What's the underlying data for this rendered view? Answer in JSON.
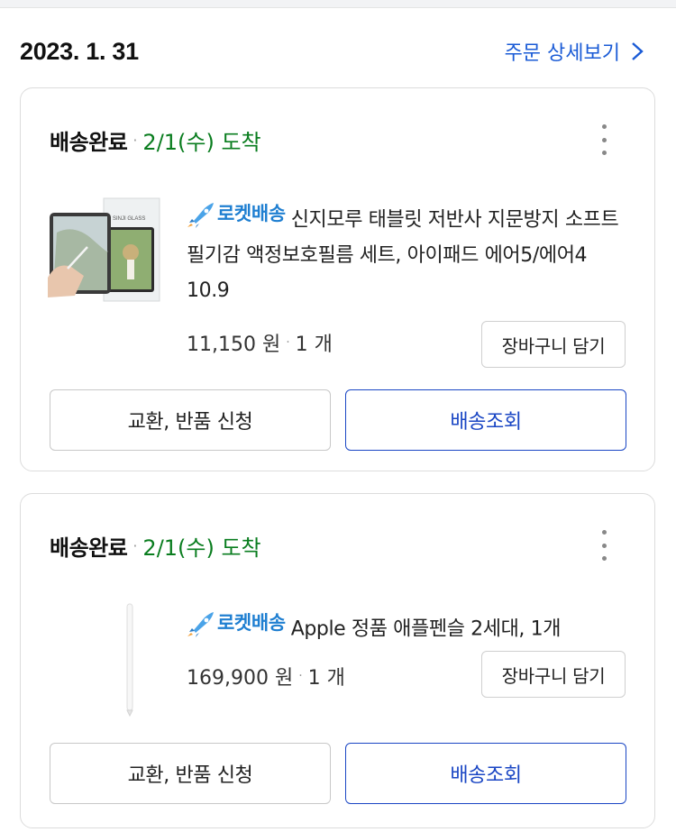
{
  "order": {
    "date": "2023. 1. 31",
    "detail_link": "주문 상세보기"
  },
  "items": [
    {
      "status": "배송완료",
      "arrival": "2/1(수) 도착",
      "rocket_label": "로켓배송",
      "name": "신지모루 태블릿 저반사 지문방지 소프트 필기감 액정보호필름 세트, 아이패드 에어5/에어4 10.9",
      "price": "11,150 원",
      "qty": "1 개",
      "cart_label": "장바구니 담기",
      "return_label": "교환, 반품 신청",
      "track_label": "배송조회",
      "thumb_brand": "SINJI GLASS"
    },
    {
      "status": "배송완료",
      "arrival": "2/1(수) 도착",
      "rocket_label": "로켓배송",
      "name": "Apple 정품 애플펜슬 2세대, 1개",
      "price": "169,900 원",
      "qty": "1 개",
      "cart_label": "장바구니 담기",
      "return_label": "교환, 반품 신청",
      "track_label": "배송조회"
    }
  ],
  "icons": {
    "chevron": "chevron-right-icon",
    "more": "more-vertical-icon",
    "rocket": "rocket-icon"
  },
  "colors": {
    "link": "#1a5bd6",
    "arrival": "#0a7d1f",
    "rocket": "#1f7fd1",
    "primary_button": "#1a46c4"
  }
}
